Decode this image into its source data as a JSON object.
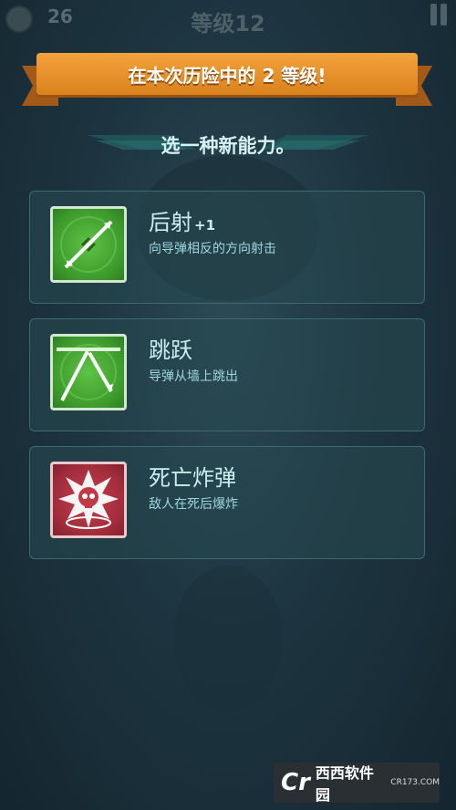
{
  "topbar": {
    "coins": "26",
    "level_title": "等级12"
  },
  "banner": {
    "text": "在本次历险中的 2 等级!"
  },
  "choose": {
    "text": "选一种新能力。"
  },
  "abilities": [
    {
      "name": "后射",
      "bonus": "+1",
      "desc": "向导弹相反的方向射击",
      "icon": "twin-missiles-icon"
    },
    {
      "name": "跳跃",
      "bonus": "",
      "desc": "导弹从墙上跳出",
      "icon": "wall-bounce-icon"
    },
    {
      "name": "死亡炸弹",
      "bonus": "",
      "desc": "敌人在死后爆炸",
      "icon": "skull-explosion-icon"
    }
  ],
  "watermark": {
    "logo": "Cr",
    "cn": "西西软件园",
    "url": "CR173.COM"
  },
  "colors": {
    "banner": "#e8952c",
    "card_bg": "#284850",
    "green_icon": "#4cb23a",
    "red_icon": "#b0303e"
  }
}
